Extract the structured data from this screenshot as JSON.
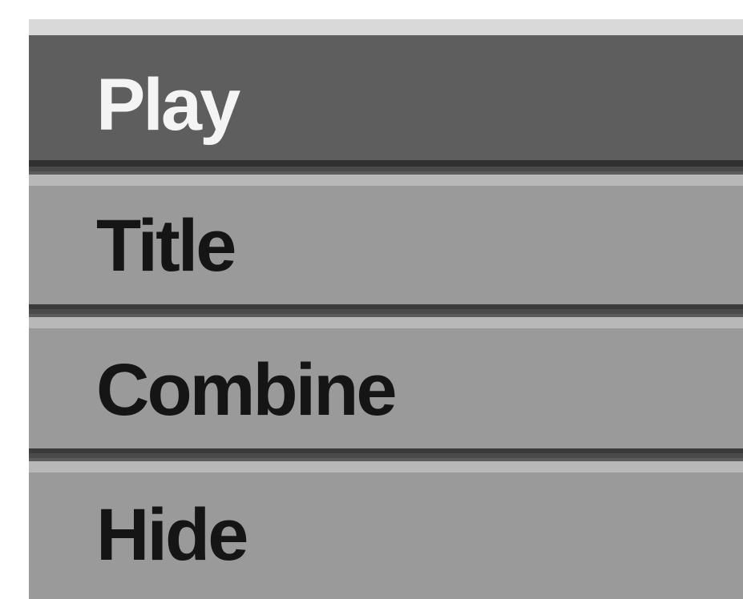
{
  "menu": {
    "items": [
      {
        "label": "Play",
        "selected": true
      },
      {
        "label": "Title",
        "selected": false
      },
      {
        "label": "Combine",
        "selected": false
      },
      {
        "label": "Hide",
        "selected": false
      }
    ]
  },
  "colors": {
    "selected_background": "#5e5e5e",
    "selected_text": "#f4f4f4",
    "item_background": "#9a9a9a",
    "item_text": "#151515",
    "highlight_edge": "#d9d9d9",
    "separator": "#3a3a3a"
  }
}
